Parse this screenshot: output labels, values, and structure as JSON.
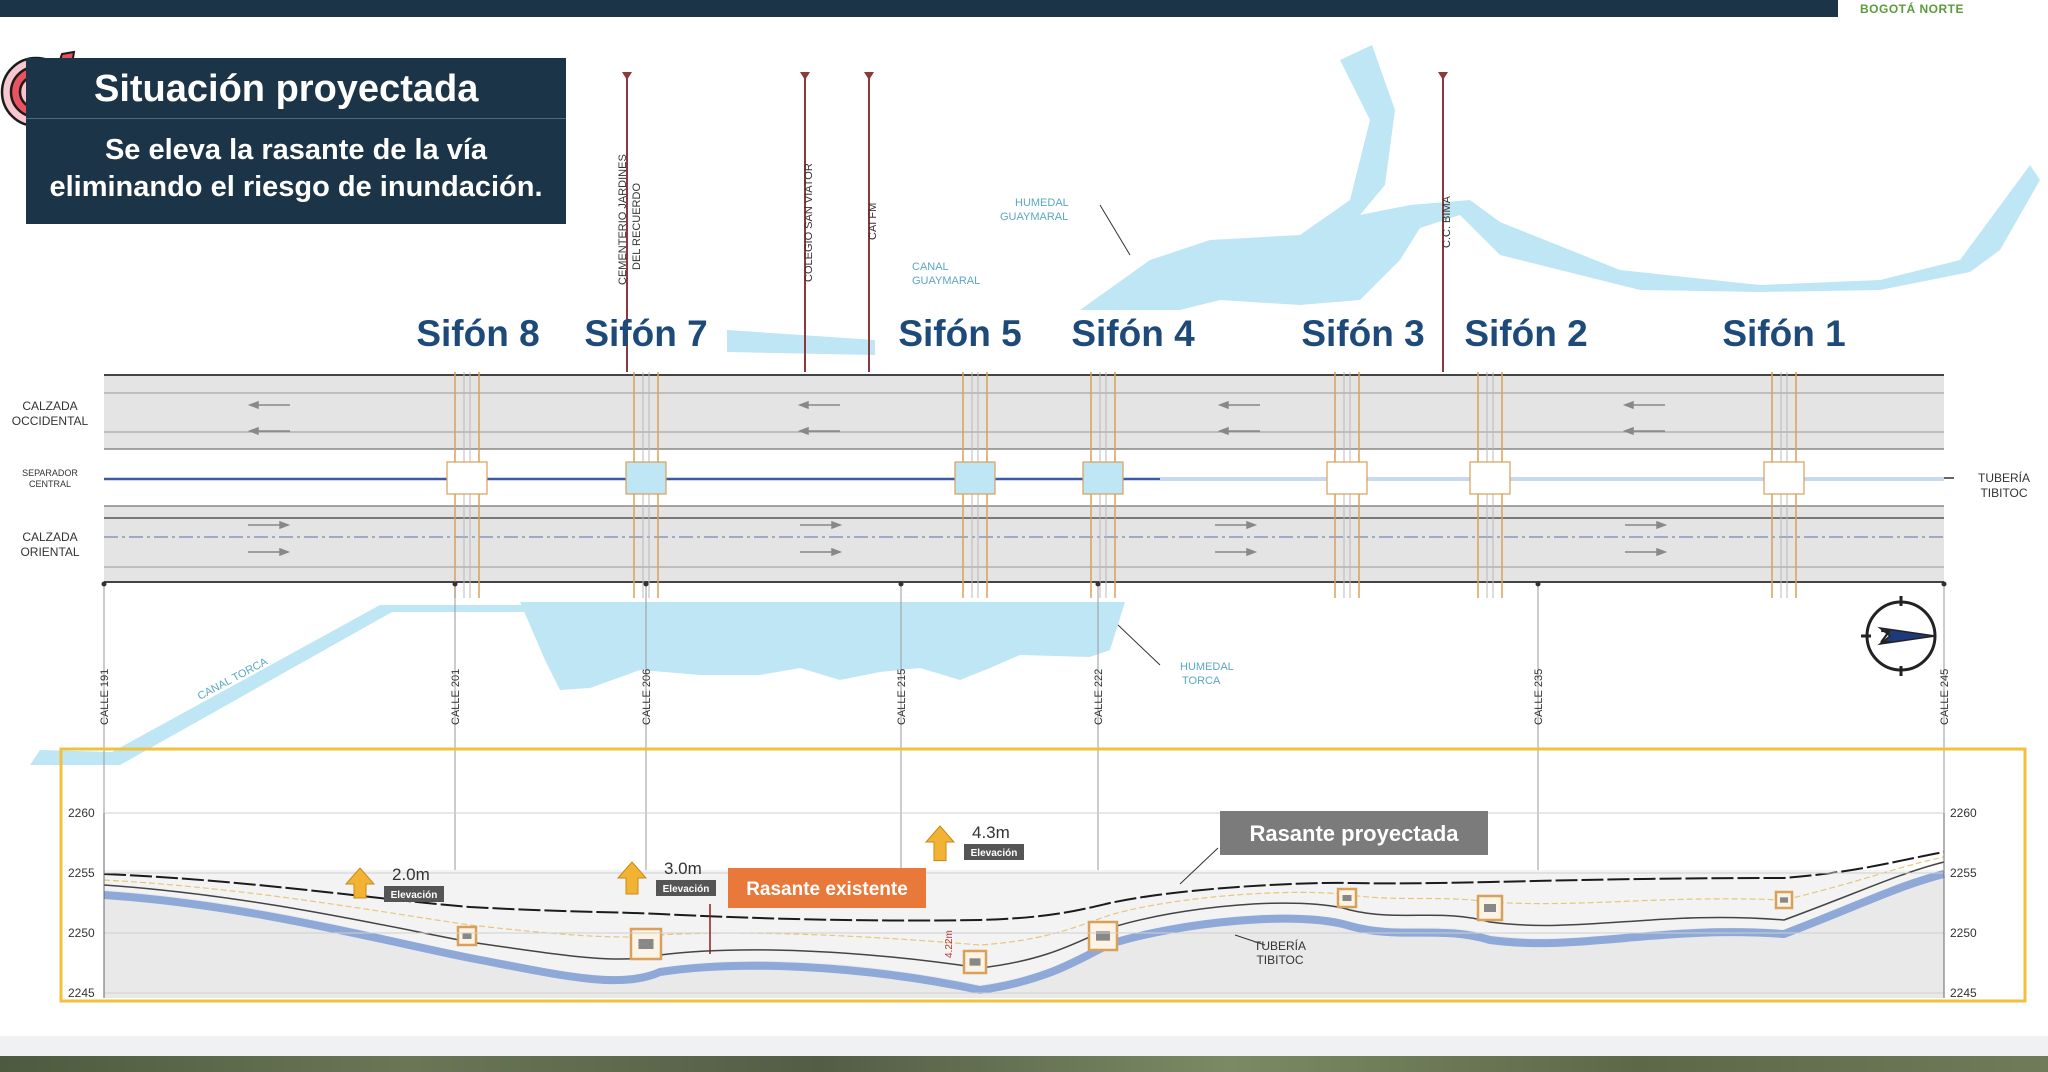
{
  "brand": {
    "line1": "BOGOTÁ NORTE"
  },
  "header": {
    "title": "Situación proyectada",
    "subtitle_line1": "Se eleva la rasante de la vía",
    "subtitle_line2": "eliminando el riesgo de inundación."
  },
  "colors": {
    "dark_navy": "#1b3447",
    "water": "#bfe6f5",
    "road": "#e4e4e4",
    "siphon_label": "#1e4a7a",
    "orange_label": "#e8793a",
    "gray_label": "#7b7b7b",
    "arrow_yellow": "#f2b233",
    "profile_frame": "#f0c23a",
    "pipe_blue": "#8ea8d8"
  },
  "siphons": [
    {
      "name": "Sifón 8"
    },
    {
      "name": "Sifón 7"
    },
    {
      "name": "Sifón 5"
    },
    {
      "name": "Sifón 4"
    },
    {
      "name": "Sifón 3"
    },
    {
      "name": "Sifón 2"
    },
    {
      "name": "Sifón 1"
    }
  ],
  "road_labels": {
    "west_line1": "CALZADA",
    "west_line2": "OCCIDENTAL",
    "median_line1": "SEPARADOR",
    "median_line2": "CENTRAL",
    "east_line1": "CALZADA",
    "east_line2": "ORIENTAL",
    "pipe_line1": "TUBERÍA",
    "pipe_line2": "TIBITOC"
  },
  "landmarks": {
    "cemetery_line1": "CEMENTERIO JARDINES",
    "cemetery_line2": "DEL RECUERDO",
    "school": "COLEGIO SAN VIATOR",
    "cai": "CAI FM",
    "cc_bima": "C.C. BIMA",
    "humedal_guaymaral_line1": "HUMEDAL",
    "humedal_guaymaral_line2": "GUAYMARAL",
    "canal_guaymaral_line1": "CANAL",
    "canal_guaymaral_line2": "GUAYMARAL",
    "humedal_torca_line1": "HUMEDAL",
    "humedal_torca_line2": "TORCA",
    "canal_torca": "CANAL TORCA"
  },
  "streets": [
    "CALLE 191",
    "CALLE 201",
    "CALLE 206",
    "CALLE 215",
    "CALLE 222",
    "CALLE 235",
    "CALLE 245"
  ],
  "elevation_axis": [
    "2260",
    "2255",
    "2250",
    "2245"
  ],
  "elevations": [
    {
      "value": "2.0m",
      "tag": "Elevación",
      "meters": 2.0
    },
    {
      "value": "3.0m",
      "tag": "Elevación",
      "meters": 3.0
    },
    {
      "value": "4.3m",
      "tag": "Elevación",
      "meters": 4.3
    }
  ],
  "profile_labels": {
    "projected": "Rasante proyectada",
    "existing": "Rasante existente",
    "pipe_line1": "TUBERÍA",
    "pipe_line2": "TIBITOC",
    "depth_mark": "4.22m"
  }
}
